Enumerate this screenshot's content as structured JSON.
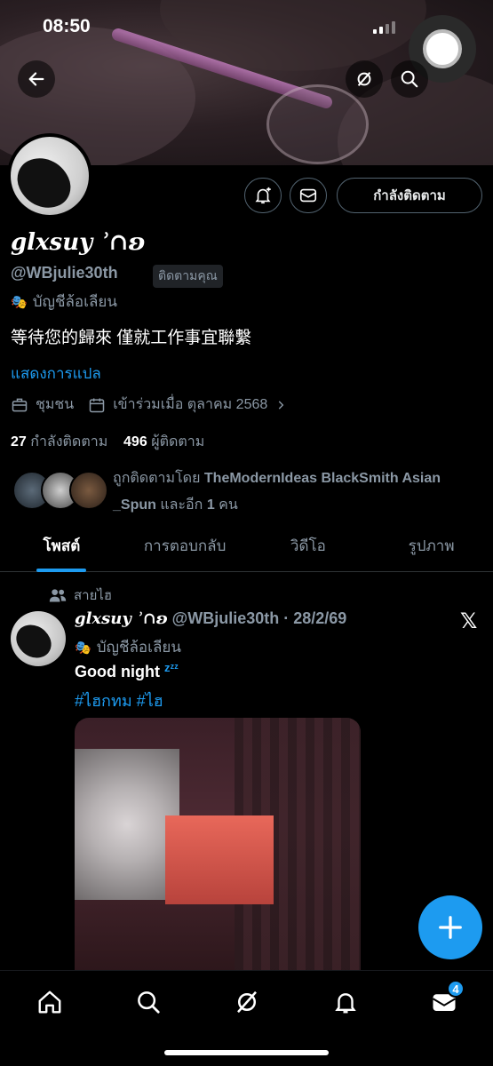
{
  "status": {
    "time": "08:50"
  },
  "profile": {
    "name": "glxsuy ʾ∩ʚ",
    "handle": "@WBjulie30th",
    "follows_you": "ติดตามคุณ",
    "parody_label": "บัญชีล้อเลียน",
    "bio": "等待您的歸來 僅就工作事宜聯繫",
    "translate": "แสดงการแปล",
    "community": "ชุมชน",
    "joined": "เข้าร่วมเมื่อ ตุลาคม 2568",
    "following_count": "27",
    "following_label": "กำลังติดตาม",
    "followers_count": "496",
    "followers_label": "ผู้ติดตาม",
    "followed_by_prefix": "ถูกติดตามโดย",
    "followed_by_names": "TheModernIdeas BlackSmith Asian _Spun",
    "followed_by_suffix": "และอีก",
    "followed_by_more": "1",
    "followed_by_unit": "คน",
    "follow_button": "กำลังติดตาม"
  },
  "tabs": [
    {
      "label": "โพสต์"
    },
    {
      "label": "การตอบกลับ"
    },
    {
      "label": "วิดีโอ"
    },
    {
      "label": "รูปภาพ"
    }
  ],
  "post": {
    "context": "สายไฮ",
    "name": "glxsuy ʾ∩ʚ",
    "handle_date": "@WBjulie30th · 28/2/69",
    "parody_label": "บัญชีล้อเลียน",
    "text": "Good night",
    "zzz": "zᶻᶻ",
    "hashtags": "#ไฮกทม #ไฮ"
  },
  "nav": {
    "messages_badge": "4"
  },
  "colors": {
    "accent": "#1d9bf0",
    "background": "#000000",
    "secondary_text": "#8b98a5"
  },
  "icons": [
    "back-arrow-icon",
    "grok-icon",
    "search-icon",
    "more-icon",
    "notify-plus-icon",
    "mail-icon",
    "community-icon",
    "calendar-icon",
    "chevron-right-icon",
    "x-logo-icon",
    "plus-icon",
    "home-icon",
    "explore-icon",
    "bell-icon",
    "envelope-icon"
  ]
}
